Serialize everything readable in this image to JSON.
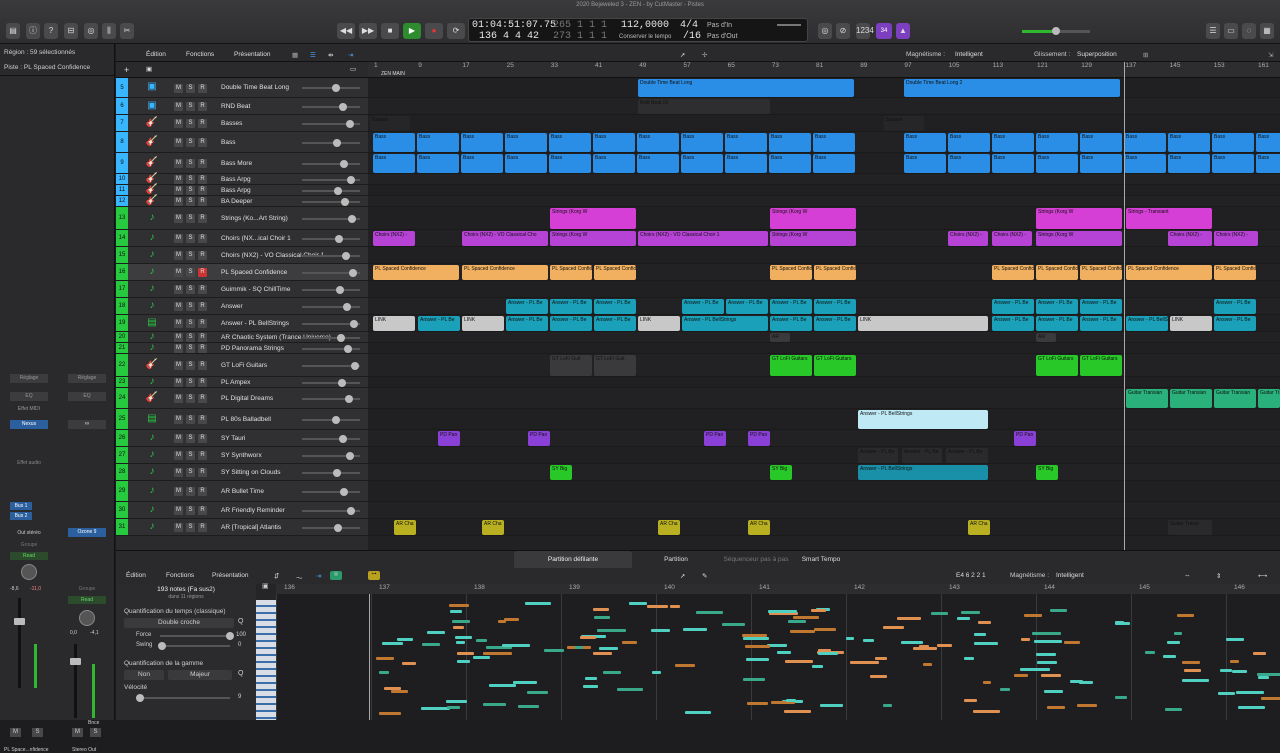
{
  "window": {
    "title": "2020 Bejeweled 3 - ZEN - by CutMaster - Pistes"
  },
  "lcd": {
    "time": "01:04:51:07.75",
    "bars": "136  4  4    42",
    "frames1": "265  1  1      1",
    "frames2": "273  1  1      1",
    "tempo": "112,0000",
    "tempo_label": "Conserver le tempo",
    "sig_top": "4/4",
    "sig_bottom": "/16",
    "in_label": "Pas d'In",
    "out_label": "Pas d'Out"
  },
  "toolbar": {
    "region_badge": "34"
  },
  "left_panel": {
    "region_label": "Région : 59 sélectionnés",
    "track_label": "Piste : PL Spaced Confidence",
    "ch1": {
      "setting": "Réglage",
      "eq": "EQ",
      "midi_fx": "Effet MIDI",
      "plugin": "Nexus",
      "audio_fx": "Effet audio",
      "bus1": "Bus 1",
      "bus2": "Bus 2",
      "out": "Out stéréo",
      "group": "Groupe",
      "auto": "Read",
      "val1": "-8,6",
      "val2": "-11,0",
      "m": "M",
      "s": "S",
      "name": "PL Space...nfidence"
    },
    "ch2": {
      "setting": "Réglage",
      "eq": "EQ",
      "plugin": "Ozone 9",
      "group": "Groupe",
      "auto": "Read",
      "val1": "0,0",
      "val2": "-4,1",
      "bounce": "Bnce",
      "m": "M",
      "s": "S",
      "name": "Stereo Out"
    }
  },
  "arrange_menu": {
    "edit": "Édition",
    "functions": "Fonctions",
    "presentation": "Présentation",
    "snap_label": "Magnétisme :",
    "snap_value": "Intelligent",
    "drag_label": "Glissement :",
    "drag_value": "Superposition"
  },
  "ruler": {
    "marks": [
      "1",
      "9",
      "17",
      "25",
      "33",
      "41",
      "49",
      "57",
      "65",
      "73",
      "81",
      "89",
      "97",
      "105",
      "113",
      "121",
      "129",
      "137",
      "145",
      "153",
      "161"
    ],
    "marker": "ZEN MAIN"
  },
  "tracks": [
    {
      "num": "5",
      "name": "Double Time Beat Long",
      "color": "#38b6ff",
      "icon": "drum-machine-icon"
    },
    {
      "num": "6",
      "name": "RND Beat",
      "color": "#38b6ff",
      "icon": "drum-machine-icon"
    },
    {
      "num": "7",
      "name": "Basses",
      "color": "#38b6ff",
      "icon": "bass-guitar-icon",
      "folder": true
    },
    {
      "num": "8",
      "name": "Bass",
      "color": "#38b6ff",
      "icon": "bass-guitar-icon"
    },
    {
      "num": "9",
      "name": "Bass More",
      "color": "#38b6ff",
      "icon": "bass-guitar-icon"
    },
    {
      "num": "10",
      "name": "Bass Arpg",
      "color": "#38b6ff",
      "icon": "bass-guitar-icon"
    },
    {
      "num": "11",
      "name": "Bass Arpg",
      "color": "#38b6ff",
      "icon": "bass-guitar-icon"
    },
    {
      "num": "12",
      "name": "BA Deeper",
      "color": "#38b6ff",
      "icon": "bass-guitar-icon"
    },
    {
      "num": "13",
      "name": "Strings (Ko...Art String)",
      "color": "#27c93f",
      "icon": "strings-icon"
    },
    {
      "num": "14",
      "name": "Choirs (NX...ical Choir 1",
      "color": "#27c93f",
      "icon": "choir-icon"
    },
    {
      "num": "15",
      "name": "Choirs (NX2) - VO Classical Choir 1",
      "color": "#27c93f",
      "icon": "choir-icon"
    },
    {
      "num": "16",
      "name": "PL Spaced Confidence",
      "color": "#27c93f",
      "icon": "synth-icon"
    },
    {
      "num": "17",
      "name": "Guimmik - SQ ChillTime",
      "color": "#27c93f",
      "icon": "synth-icon"
    },
    {
      "num": "18",
      "name": "Answer",
      "color": "#27c93f",
      "icon": "synth-icon"
    },
    {
      "num": "19",
      "name": "Answer - PL BellStrings",
      "color": "#27c93f",
      "icon": "keyboard-icon"
    },
    {
      "num": "20",
      "name": "AR Chaotic System (Trance Universe)",
      "color": "#27c93f",
      "icon": "synth-icon"
    },
    {
      "num": "21",
      "name": "PD Panorama Strings",
      "color": "#27c93f",
      "icon": "synth-icon"
    },
    {
      "num": "22",
      "name": "GT LoFi Guitars",
      "color": "#27c93f",
      "icon": "guitar-icon"
    },
    {
      "num": "23",
      "name": "PL Ampex",
      "color": "#27c93f",
      "icon": "synth-icon"
    },
    {
      "num": "24",
      "name": "PL Digital Dreams",
      "color": "#27c93f",
      "icon": "guitar-icon"
    },
    {
      "num": "25",
      "name": "PL 80s Balladbell",
      "color": "#27c93f",
      "icon": "keyboard-icon"
    },
    {
      "num": "26",
      "name": "SY Tauri",
      "color": "#27c93f",
      "icon": "synth-icon"
    },
    {
      "num": "27",
      "name": "SY Synthworx",
      "color": "#27c93f",
      "icon": "synth-icon"
    },
    {
      "num": "28",
      "name": "SY Sitting on Clouds",
      "color": "#27c93f",
      "icon": "synth-icon"
    },
    {
      "num": "29",
      "name": "AR Bullet Time",
      "color": "#27c93f",
      "icon": "synth-icon"
    },
    {
      "num": "30",
      "name": "AR Friendly Reminder",
      "color": "#27c93f",
      "icon": "synth-icon"
    },
    {
      "num": "31",
      "name": "AR [Tropical] Atlantis",
      "color": "#27c93f",
      "icon": "synth-icon"
    }
  ],
  "msr": {
    "m": "M",
    "s": "S",
    "r": "R",
    "i": "I"
  },
  "regions": {
    "double_time": "Double Time Beat Long",
    "double_time2": "Double Time Beat Long 2",
    "rnb": "RnB Beat 01",
    "basses": "Basses",
    "bass": "Bass",
    "strings": "Strings (Korg W",
    "strings_transiant": "Strings - Transiant",
    "choirs": "Choirs (NX2) -",
    "choirs_long": "Choirs (NX2) - VO Classical Cho",
    "choirs_long2": "Choirs (NX2) - VO Classical Choir 1",
    "spaced": "PL Spaced Confidence",
    "answer": "Answer - PL Be",
    "answer_bell": "Answer - PL BellStrings",
    "link": "LINK",
    "ar": "AR",
    "gt": "GT LoFi Guit",
    "gt2": "GT LoFi Guitars",
    "guitar_trans": "Guitar Transian",
    "pd": "PD Pan",
    "sy": "SY Big",
    "archa": "AR Cha",
    "guitar_trans2": "Guitar Transi"
  },
  "bottom_tabs": [
    "Partition défilante",
    "Partition",
    "Séquenceur pas à pas",
    "Smart Tempo"
  ],
  "editor": {
    "menu_edit": "Édition",
    "menu_functions": "Fonctions",
    "menu_presentation": "Présentation",
    "position": "E4   6 2 2 1",
    "snap_label": "Magnétisme :",
    "snap_value": "Intelligent",
    "notes_info": "193 notes (Fa sus2)",
    "notes_sub": "dans 11 régions",
    "quant_title": "Quantification du temps (classique)",
    "quant_value": "Double croche",
    "force_label": "Force",
    "force_value": "100",
    "swing_label": "Swing",
    "swing_value": "0",
    "scale_title": "Quantification de la gamme",
    "scale_left": "Non",
    "scale_right": "Majeur",
    "velocity_label": "Vélocité",
    "velocity_value": "9",
    "ruler": [
      "136",
      "137",
      "138",
      "139",
      "140",
      "141",
      "142",
      "143",
      "144",
      "145",
      "146"
    ]
  }
}
